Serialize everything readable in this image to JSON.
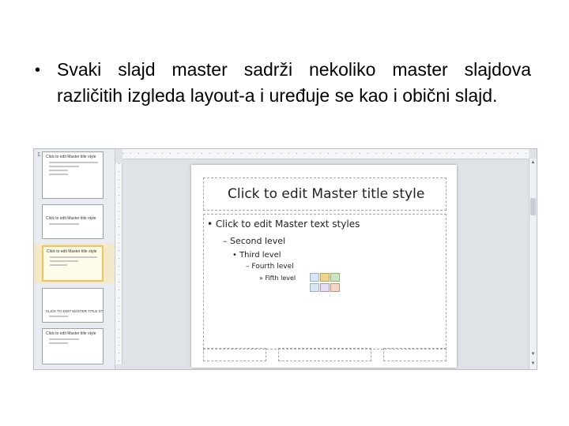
{
  "bullet": {
    "glyph": "•",
    "text": "Svaki slajd master sadrži nekoliko master slajdova različitih izgleda layout-a i uređuje se kao i obični slajd."
  },
  "screenshot": {
    "thumbnails": [
      {
        "number": "1",
        "title": "Click to edit Master title style"
      },
      {
        "number": "",
        "title": "Click to edit Master title style"
      },
      {
        "number": "",
        "title": "Click to edit Master title style"
      },
      {
        "number": "",
        "title": "CLICK TO EDIT MASTER TITLE STYLE"
      },
      {
        "number": "",
        "title": "Click to edit Master title style"
      }
    ],
    "slide": {
      "title": "Click to edit Master title style",
      "levels": [
        "• Click to edit Master text styles",
        "– Second level",
        "• Third level",
        "– Fourth level",
        "» Fifth level"
      ],
      "footer_left": "",
      "footer_center": "",
      "footer_right": ""
    },
    "colors": {
      "selection": "#f1c35b",
      "canvas": "#dfe3e8"
    }
  }
}
